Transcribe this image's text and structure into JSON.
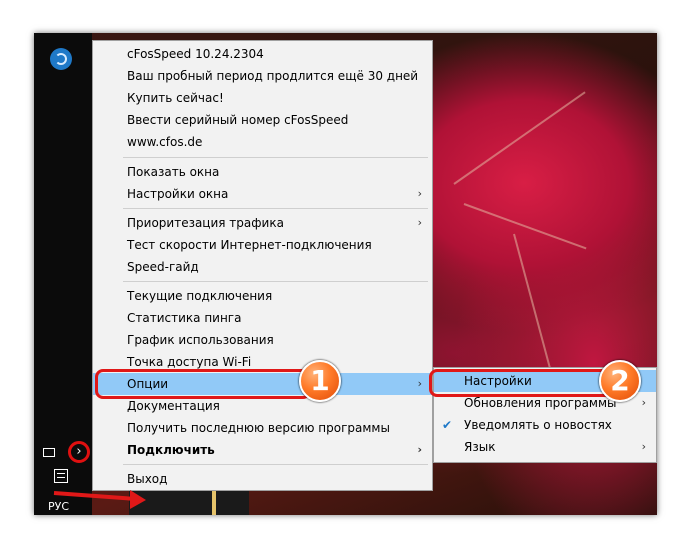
{
  "menu": {
    "items": [
      {
        "label": "cFosSpeed 10.24.2304"
      },
      {
        "label": "Ваш пробный период продлится ещё 30 дней"
      },
      {
        "label": "Купить сейчас!"
      },
      {
        "label": "Ввести серийный номер cFosSpeed"
      },
      {
        "label": "www.cfos.de"
      },
      {
        "label": "Показать окна"
      },
      {
        "label": "Настройки окна",
        "submenu": true
      },
      {
        "label": "Приоритезация трафика",
        "submenu": true
      },
      {
        "label": "Тест скорости Интернет-подключения"
      },
      {
        "label": "Speed-гайд"
      },
      {
        "label": "Текущие подключения"
      },
      {
        "label": "Статистика пинга"
      },
      {
        "label": "График использования"
      },
      {
        "label": "Точка доступа Wi-Fi"
      },
      {
        "label": "Опции",
        "submenu": true,
        "highlighted": true
      },
      {
        "label": "Документация"
      },
      {
        "label": "Получить последнюю версию программы"
      },
      {
        "label": "Подключить",
        "submenu": true,
        "bold": true
      },
      {
        "label": "Выход"
      }
    ]
  },
  "submenu": {
    "items": [
      {
        "label": "Настройки",
        "highlighted": true
      },
      {
        "label": "Обновления программы",
        "submenu": true
      },
      {
        "label": "Уведомлять о новостях",
        "checked": true
      },
      {
        "label": "Язык",
        "submenu": true
      }
    ]
  },
  "taskbar": {
    "language": "РУС",
    "chevron": "›"
  },
  "annotations": {
    "badge1": "1",
    "badge2": "2"
  },
  "colors": {
    "highlight": "#91c9f7",
    "annotation_red": "#e01818",
    "badge_orange": "#ff7a28"
  }
}
